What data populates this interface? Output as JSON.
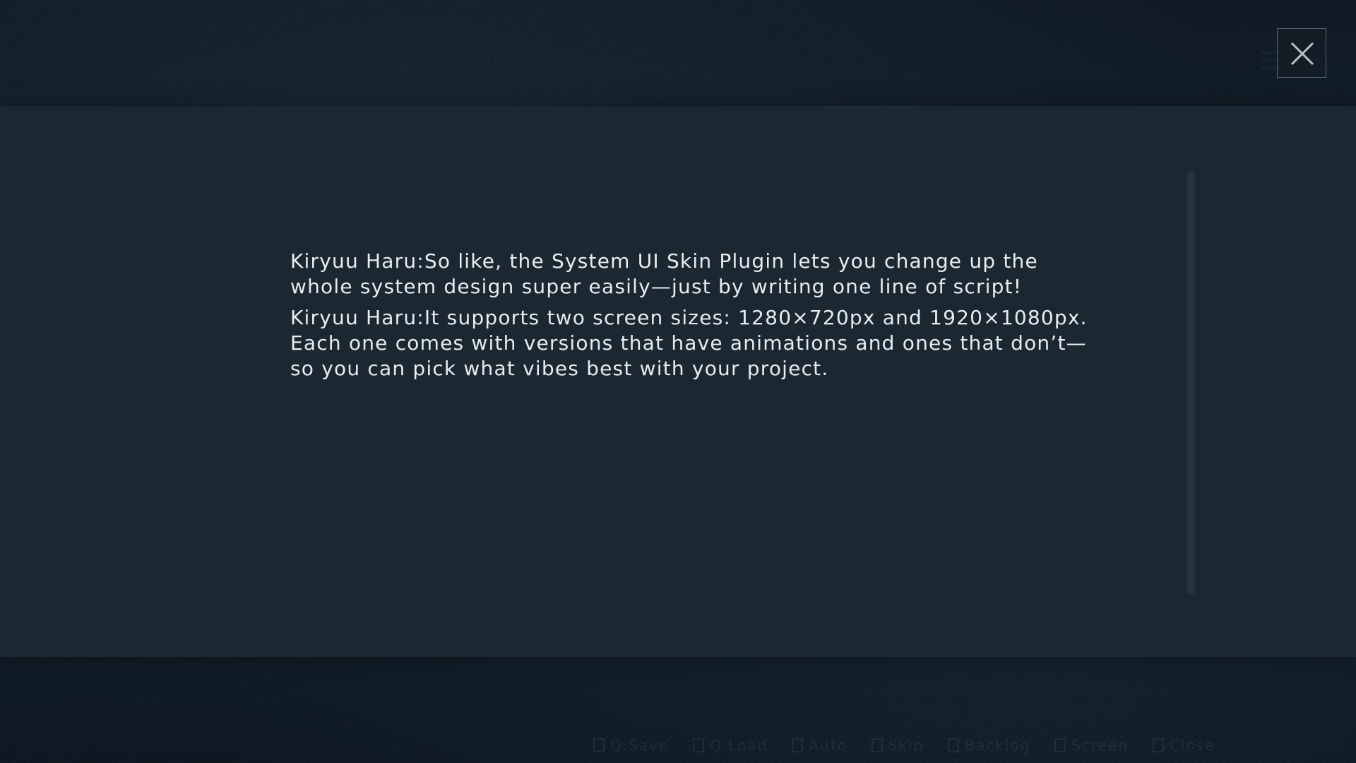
{
  "backlog": {
    "entries": [
      {
        "speaker": "Kiryuu Haru:",
        "text": "So like, the System UI Skin Plugin lets you change up the whole system design super easily—just by writing one line of script!"
      },
      {
        "speaker": "Kiryuu Haru:",
        "text": "It supports two screen sizes: 1280×720px and 1920×1080px. Each one comes with versions that have animations and ones that don’t—so you can pick what vibes best with your project."
      }
    ]
  },
  "close_button": {
    "icon": "close-icon"
  },
  "quick_menu": {
    "items": [
      {
        "label": "Q.Save",
        "icon": "save-icon"
      },
      {
        "label": "Q.Load",
        "icon": "load-icon"
      },
      {
        "label": "Auto",
        "icon": "auto-icon"
      },
      {
        "label": "Skip",
        "icon": "skip-icon"
      },
      {
        "label": "Backlog",
        "icon": "backlog-icon"
      },
      {
        "label": "Screen",
        "icon": "screen-icon"
      },
      {
        "label": "Close",
        "icon": "close-icon"
      }
    ]
  },
  "colors": {
    "panel": "#1c2832",
    "text": "#e7ecef",
    "button_border": "#5b6a75"
  }
}
